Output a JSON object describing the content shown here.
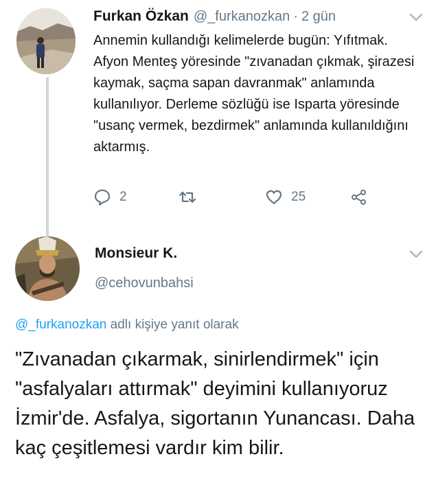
{
  "tweet1": {
    "author_name": "Furkan Özkan",
    "author_handle": "@_furkanozkan",
    "separator": "·",
    "time": "2 gün",
    "text": "Annemin kullandığı kelimelerde bugün: Yıfıtmak. Afyon Menteş yöresinde \"zıvanadan çıkmak, şirazesi kaymak, saçma sapan davranmak\" anlamında kullanılıyor. Derleme sözlüğü ise Isparta yöresinde \"usanç vermek, bezdirmek\" anlamında kullanıldığını aktarmış.",
    "actions": {
      "reply_icon": "reply-icon",
      "reply_count": "2",
      "retweet_icon": "retweet-icon",
      "like_icon": "heart-icon",
      "like_count": "25",
      "share_icon": "share-icon"
    }
  },
  "tweet2": {
    "author_name": "Monsieur K.",
    "author_handle": "@cehovunbahsi",
    "reply_to_handle": "@_furkanozkan",
    "reply_to_suffix": " adlı kişiye yanıt olarak",
    "text": "\"Zıvanadan çıkarmak, sinirlendirmek\" için \"asfalyaları attırmak\" deyimini kullanıyoruz İzmir'de. Asfalya, sigortanın Yunancası. Daha kaç çeşitlemesi vardır kim bilir."
  },
  "colors": {
    "text": "#14171a",
    "muted": "#657786",
    "link": "#1da1f2",
    "thread_line": "#ccd6dd"
  }
}
